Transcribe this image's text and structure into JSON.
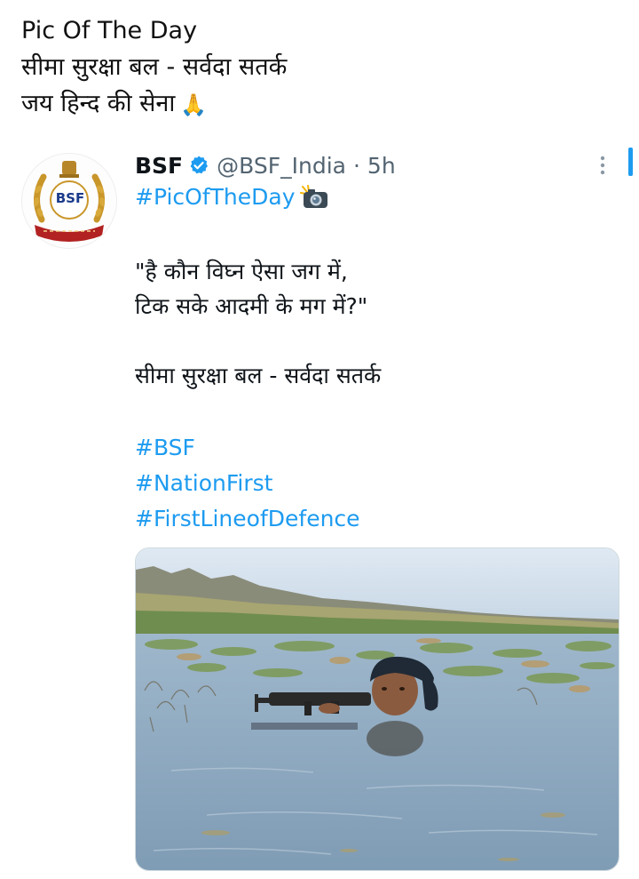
{
  "caption": {
    "line1": "Pic Of The Day",
    "line2": "सीमा सुरक्षा बल - सर्वदा सतर्क",
    "line3": "जय हिन्द की सेना",
    "emoji": "🙏"
  },
  "tweet": {
    "author_name": "BSF",
    "handle": "@BSF_India",
    "separator": "·",
    "time": "5h",
    "hashtag_title": "#PicOfTheDay",
    "avatar_label": "BSF",
    "body_lines": [
      "\"है कौन विघ्न ऐसा जग में,",
      "टिक सके आदमी के मग में?\"",
      "",
      "सीमा सुरक्षा बल - सर्वदा सतर्क"
    ],
    "hashtags": [
      "#BSF",
      "#NationFirst",
      "#FirstLineofDefence"
    ],
    "icons": {
      "verified": "verified-badge-icon",
      "camera": "camera-flash-icon",
      "more": "more-options-icon",
      "pray": "folded-hands-icon"
    }
  },
  "colors": {
    "link": "#1d9bf0",
    "muted": "#536471",
    "text": "#0f1419"
  }
}
